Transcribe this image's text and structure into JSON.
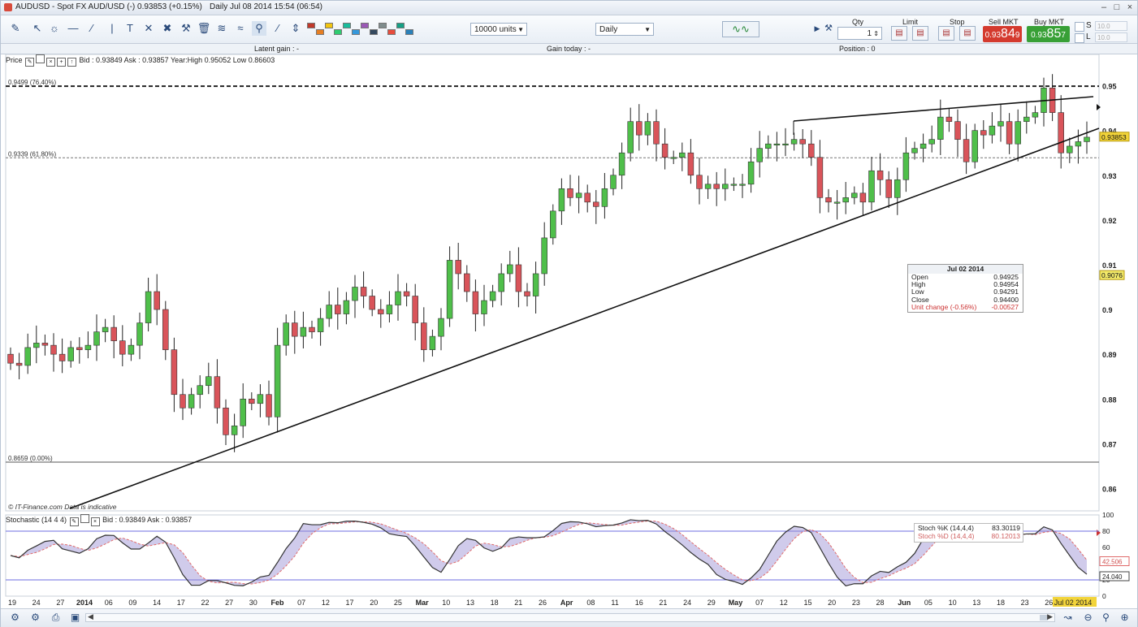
{
  "window": {
    "title": "AUDUSD - Spot FX AUD/USD (-)   0.93853 (+0.15%)",
    "date_label": "Daily  Jul 08 2014 15:54 (06:54)"
  },
  "toolbar": {
    "units_select": "10000 units",
    "period_select": "Daily",
    "qty_label": "Qty",
    "qty_value": "1",
    "limit_label": "Limit",
    "stop_label": "Stop",
    "sell_label": "Sell MKT",
    "buy_label": "Buy MKT",
    "sell_price_small": "0.93",
    "sell_price_big": "84",
    "sell_price_sup": "9",
    "buy_price_small": "0.93",
    "buy_price_big": "85",
    "buy_price_sup": "7",
    "s_label": "S",
    "l_label": "L",
    "s_value": "10.0",
    "l_value": "10.0",
    "colors": [
      "#c0392b",
      "#e67e22",
      "#f1c40f",
      "#2ecc71",
      "#1abc9c",
      "#3498db",
      "#9b59b6",
      "#34495e",
      "#7f8c8d",
      "#e74c3c",
      "#16a085",
      "#2980b9"
    ]
  },
  "status": {
    "latent_gain": "Latent gain : -",
    "gain_today": "Gain today : -",
    "position": "Position : 0"
  },
  "price_panel": {
    "label": "Price",
    "info": "Bid : 0.93849 Ask : 0.93857 Year:High 0.95052 Low 0.86603",
    "fib_top": "0.9499 (76.40%)",
    "fib_mid": "0.9339 (61.80%)",
    "fib_bot": "0.8659 (0.00%)",
    "copyright": "© IT-Finance.com Data is indicative",
    "current_price_tag": "0.93853",
    "cursor_price_tag": "0.9076",
    "yaxis_labels": [
      "0.95",
      "0.94",
      "0.93",
      "0.92",
      "0.91",
      "0.9",
      "0.89",
      "0.88",
      "0.87",
      "0.86"
    ]
  },
  "tooltip": {
    "title": "Jul 02 2014",
    "rows": [
      {
        "k": "Open",
        "v": "0.94925"
      },
      {
        "k": "High",
        "v": "0.94954"
      },
      {
        "k": "Low",
        "v": "0.94291"
      },
      {
        "k": "Close",
        "v": "0.94400"
      }
    ],
    "change_k": "Unit change (-0.56%)",
    "change_v": "-0.00527"
  },
  "stoch_panel": {
    "label": "Stochastic (14 4 4)",
    "info": "Bid : 0.93849 Ask : 0.93857",
    "k_name": "Stoch %K (14,4,4)",
    "k_val": "83.30119",
    "d_name": "Stoch %D (14,4,4)",
    "d_val": "80.12013",
    "yaxis_labels": [
      "100",
      "80",
      "60",
      "40",
      "20",
      "0"
    ],
    "tag_d": "42.506",
    "tag_k": "24.040"
  },
  "xaxis": {
    "labels": [
      "19",
      "24",
      "27",
      "2014",
      "06",
      "09",
      "14",
      "17",
      "22",
      "27",
      "30",
      "Feb",
      "07",
      "12",
      "17",
      "20",
      "25",
      "Mar",
      "10",
      "13",
      "18",
      "21",
      "26",
      "Apr",
      "08",
      "11",
      "16",
      "21",
      "24",
      "29",
      "May",
      "07",
      "12",
      "15",
      "20",
      "23",
      "28",
      "Jun",
      "05",
      "10",
      "13",
      "18",
      "23",
      "26",
      "Jul 02 2014"
    ]
  },
  "chart_data": {
    "type": "candlestick",
    "symbol": "AUDUSD",
    "timeframe": "Daily",
    "ylim": [
      0.855,
      0.957
    ],
    "current_price": 0.93853,
    "fibonacci": [
      {
        "label": "0.9499 (76.40%)",
        "value": 0.9499
      },
      {
        "label": "0.9339 (61.80%)",
        "value": 0.9339
      },
      {
        "label": "0.8659 (0.00%)",
        "value": 0.8659
      }
    ],
    "stochastic": {
      "k_last": 83.30119,
      "d_last": 80.12013,
      "levels": [
        80,
        20
      ]
    },
    "closes": [
      0.888,
      0.8875,
      0.8915,
      0.8925,
      0.892,
      0.89,
      0.8885,
      0.8915,
      0.891,
      0.892,
      0.895,
      0.896,
      0.893,
      0.89,
      0.892,
      0.897,
      0.904,
      0.9,
      0.891,
      0.881,
      0.878,
      0.881,
      0.883,
      0.885,
      0.878,
      0.872,
      0.874,
      0.88,
      0.879,
      0.881,
      0.876,
      0.892,
      0.897,
      0.894,
      0.896,
      0.895,
      0.898,
      0.901,
      0.899,
      0.902,
      0.905,
      0.903,
      0.9,
      0.899,
      0.901,
      0.904,
      0.903,
      0.897,
      0.891,
      0.894,
      0.898,
      0.911,
      0.908,
      0.904,
      0.899,
      0.902,
      0.904,
      0.908,
      0.91,
      0.904,
      0.903,
      0.908,
      0.916,
      0.922,
      0.927,
      0.925,
      0.926,
      0.924,
      0.923,
      0.927,
      0.93,
      0.935,
      0.942,
      0.939,
      0.942,
      0.937,
      0.934,
      0.934,
      0.935,
      0.93,
      0.927,
      0.928,
      0.927,
      0.928,
      0.928,
      0.928,
      0.933,
      0.936,
      0.937,
      0.937,
      0.937,
      0.938,
      0.937,
      0.934,
      0.925,
      0.924,
      0.924,
      0.925,
      0.926,
      0.924,
      0.931,
      0.929,
      0.925,
      0.929,
      0.935,
      0.936,
      0.937,
      0.938,
      0.943,
      0.942,
      0.938,
      0.933,
      0.94,
      0.939,
      0.941,
      0.942,
      0.937,
      0.942,
      0.943,
      0.944,
      0.9495,
      0.944,
      0.935,
      0.9365,
      0.9375,
      0.9385
    ]
  }
}
